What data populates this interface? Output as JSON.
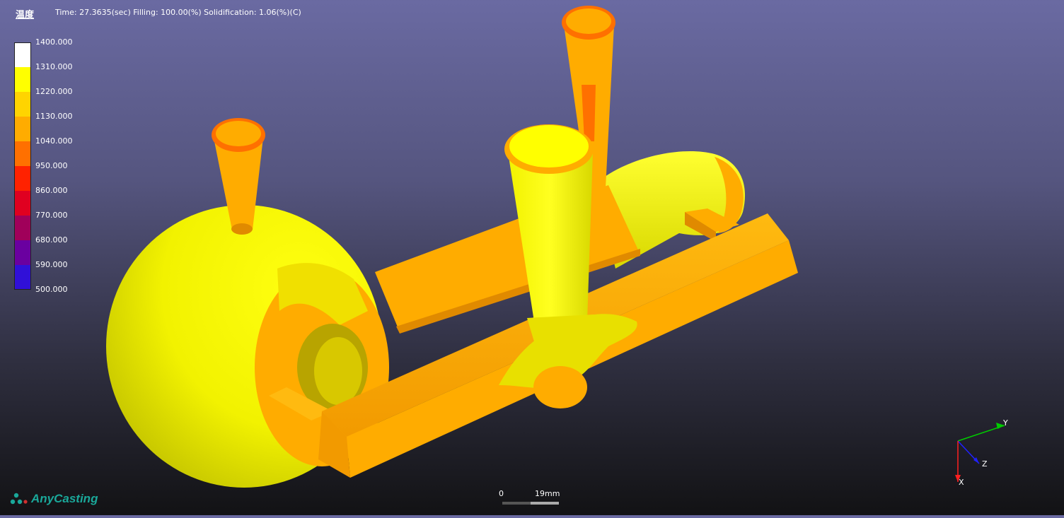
{
  "header": {
    "result_type": "温度",
    "status_line": "Time: 27.3635(sec)  Filling: 100.00(%)  Solidification:  1.06(%)(C)"
  },
  "legend": {
    "values": [
      "1400.000",
      "1310.000",
      "1220.000",
      "1130.000",
      "1040.000",
      "950.000",
      "860.000",
      "770.000",
      "680.000",
      "590.000",
      "500.000"
    ],
    "colors": [
      "#ffffff",
      "#ffff00",
      "#ffd400",
      "#ffac00",
      "#ff7000",
      "#ff2200",
      "#e00020",
      "#a0005a",
      "#6a00a0",
      "#3010d8",
      "#0000ff"
    ]
  },
  "axes": {
    "x_label": "X",
    "y_label": "Y",
    "z_label": "Z"
  },
  "scale": {
    "zero": "0",
    "length": "19mm"
  },
  "branding": {
    "logo_text": "AnyCasting"
  },
  "palette": {
    "hot": "#ffff00",
    "mid": "#ffac00",
    "rim": "#ff7000",
    "shade_yellow": "#d6d600"
  }
}
